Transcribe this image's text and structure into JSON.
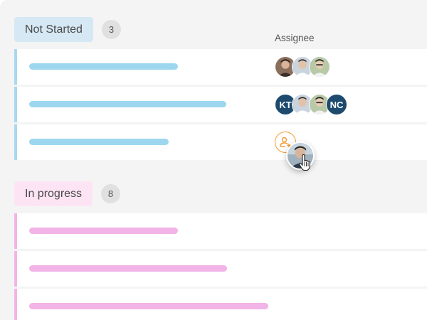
{
  "groups": [
    {
      "label": "Not Started",
      "count": "3",
      "color": "#a9d8ef",
      "rows": [
        {
          "assignees": [
            {
              "type": "photo"
            },
            {
              "type": "photo"
            },
            {
              "type": "photo"
            }
          ]
        },
        {
          "assignees": [
            {
              "type": "initials",
              "text": "KT"
            },
            {
              "type": "photo"
            },
            {
              "type": "photo"
            },
            {
              "type": "initials",
              "text": "NC"
            }
          ]
        },
        {
          "assignees": [],
          "add_icon": "add-user-icon"
        }
      ]
    },
    {
      "label": "In progress",
      "count": "8",
      "color": "#f3b5e4",
      "rows": [
        {},
        {},
        {}
      ]
    }
  ],
  "columns": {
    "assignee_header": "Assignee"
  },
  "drag": {
    "item": "avatar-photo",
    "cursor_icon": "hand-pointer-icon"
  }
}
